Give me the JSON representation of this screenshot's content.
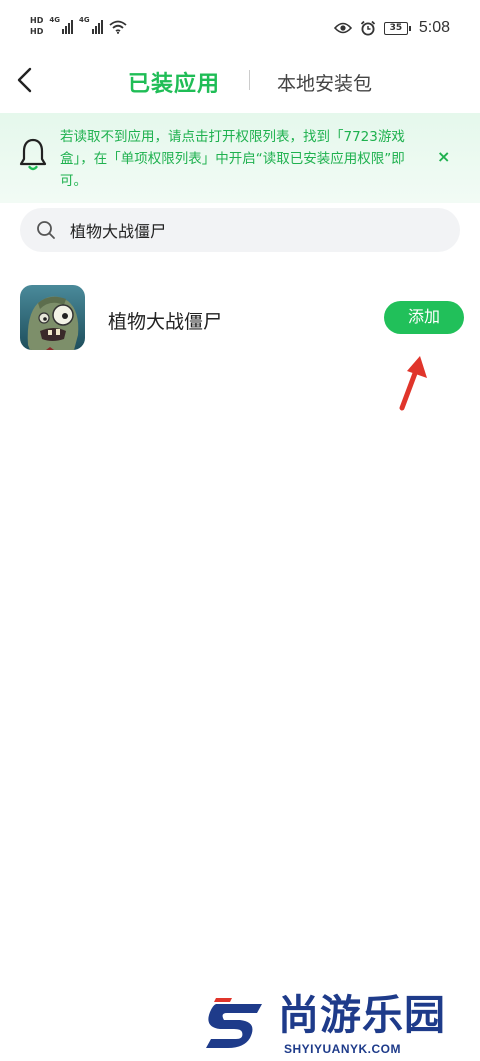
{
  "status_bar": {
    "hd_label": "HD",
    "network_type": "4G",
    "battery_level": "35",
    "time": "5:08",
    "icons": [
      "signal-icon",
      "wifi-icon",
      "eye-icon",
      "alarm-icon",
      "battery-icon"
    ]
  },
  "header": {
    "back_icon": "back-arrow-icon",
    "tabs": [
      {
        "label": "已装应用",
        "active": true
      },
      {
        "label": "本地安装包",
        "active": false
      }
    ]
  },
  "notice": {
    "icon": "bell-icon",
    "text": "若读取不到应用，请点击打开权限列表，找到「7723游戏盒」，在「单项权限列表」中开启“读取已安装应用权限”即可。",
    "close_label": "×"
  },
  "search": {
    "icon": "search-icon",
    "value": "植物大战僵尸"
  },
  "results": [
    {
      "name": "植物大战僵尸",
      "icon": "zombie-app-icon",
      "action_label": "添加"
    }
  ],
  "watermark": {
    "title": "尚游乐园",
    "url": "SHYIYUANYK.COM"
  },
  "colors": {
    "accent": "#1fbd56",
    "notice_bg": "#e8f8ee",
    "button": "#21c05a",
    "annotation": "#e0352b",
    "watermark": "#1e3b8a"
  }
}
